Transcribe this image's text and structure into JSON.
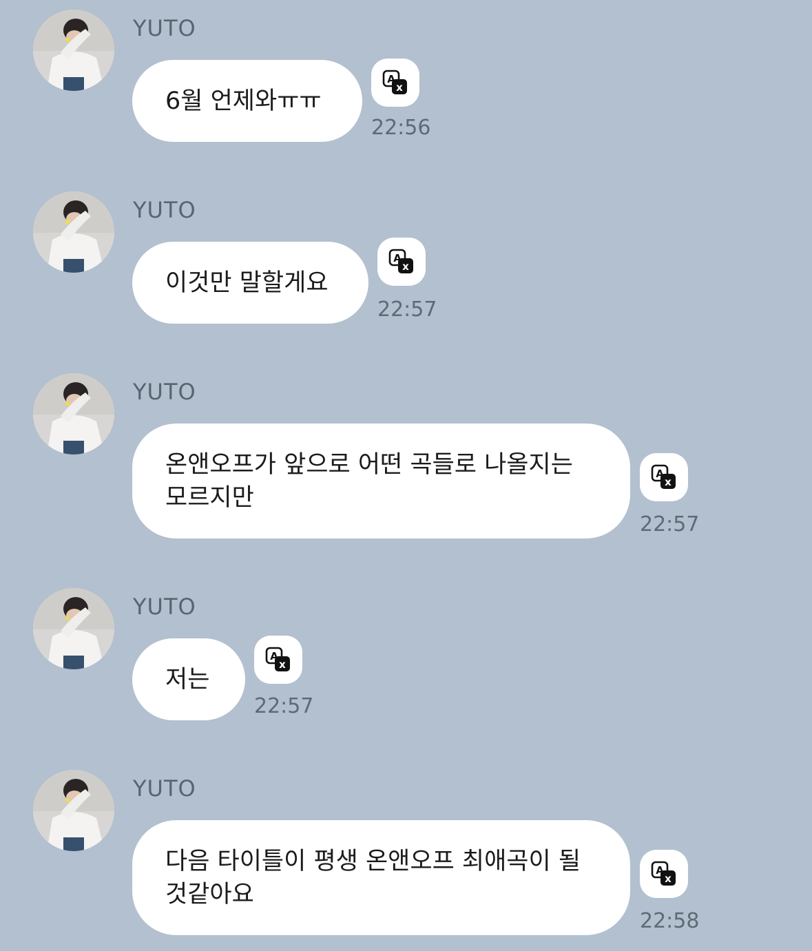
{
  "messages": [
    {
      "sender": "YUTO",
      "text": "6월 언제와ㅠㅠ",
      "time": "22:56"
    },
    {
      "sender": "YUTO",
      "text": "이것만 말할게요",
      "time": "22:57"
    },
    {
      "sender": "YUTO",
      "text": "온앤오프가 앞으로 어떤 곡들로 나올지는\n모르지만",
      "time": "22:57"
    },
    {
      "sender": "YUTO",
      "text": "저는",
      "time": "22:57"
    },
    {
      "sender": "YUTO",
      "text": "다음 타이틀이 평생 온앤오프 최애곡이 될\n것같아요",
      "time": "22:58"
    }
  ],
  "icons": {
    "translate": "translate-icon",
    "avatar": "profile-photo"
  },
  "colors": {
    "background": "#b2c0cf",
    "bubble": "#ffffff",
    "sender_text": "#5a6470",
    "time_text": "#5f6a75"
  }
}
